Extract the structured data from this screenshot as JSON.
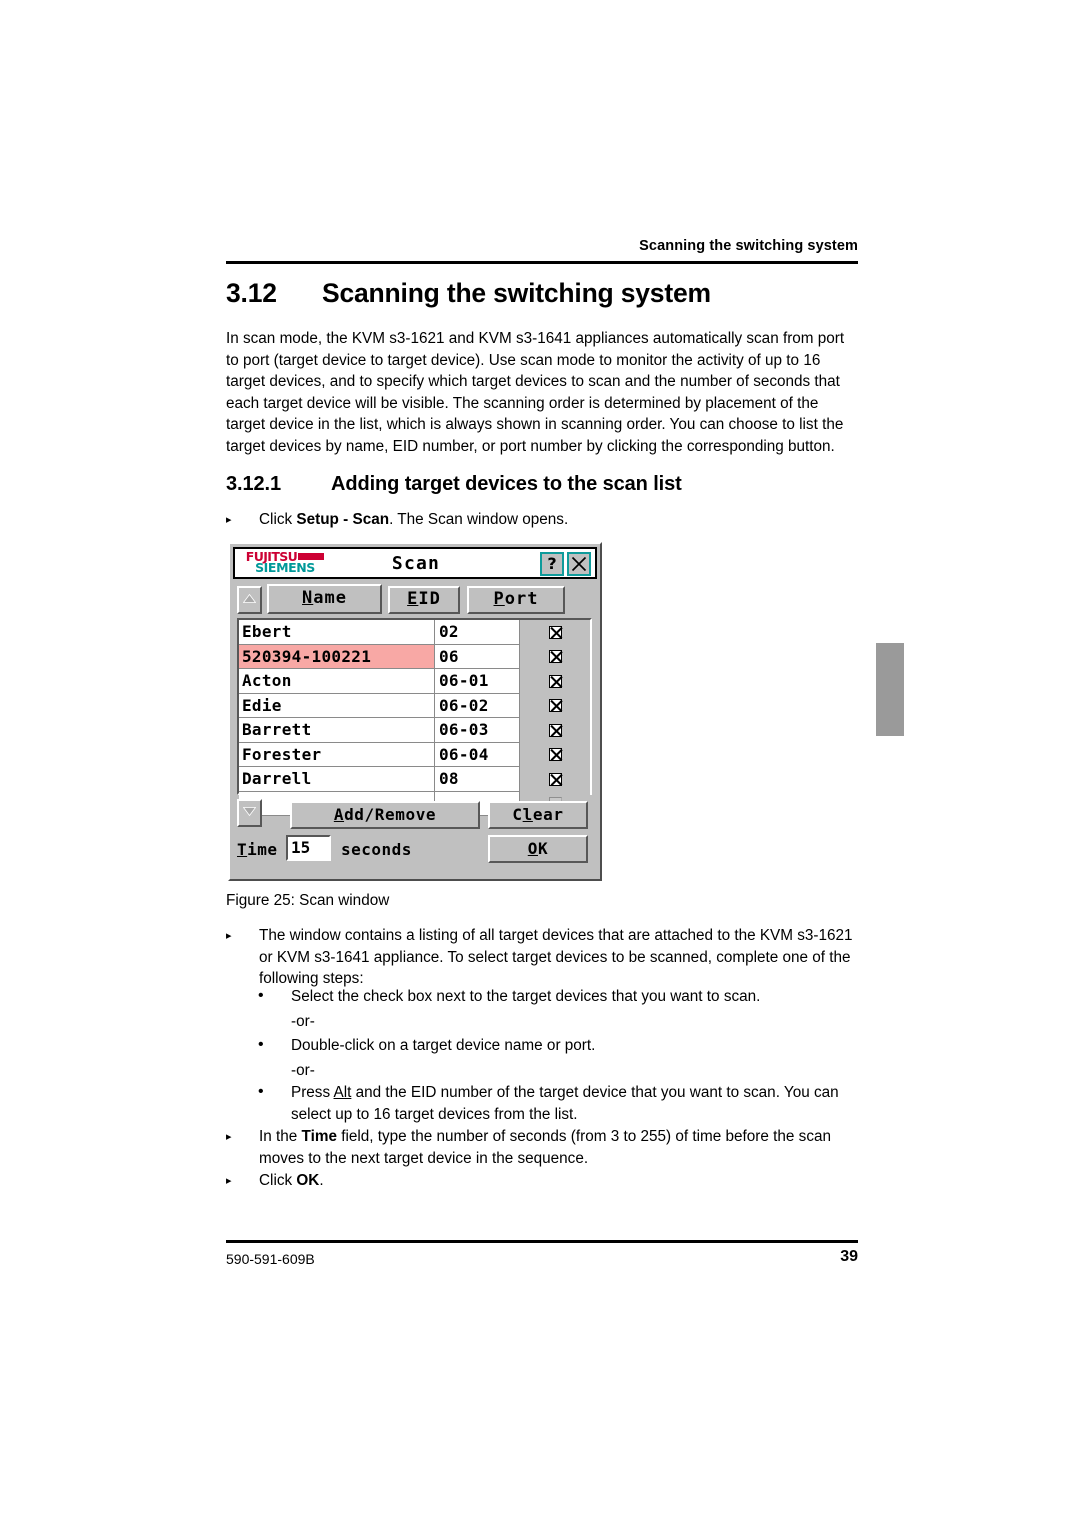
{
  "page": {
    "running_header": "Scanning the switching system",
    "footer_doc_number": "590-591-609B",
    "footer_page_number": "39"
  },
  "headings": {
    "section_number": "3.12",
    "section_title": "Scanning the switching system",
    "subsection_number": "3.12.1",
    "subsection_title": "Adding target devices to the scan list"
  },
  "body": {
    "intro_paragraph": "In scan mode, the KVM s3-1621 and KVM s3-1641 appliances automatically scan from port to port (target device to target device). Use scan mode to monitor the activity of up to 16 target devices, and to specify which target devices to scan and the number of seconds that each target device will be visible. The scanning order is determined by placement of the target device in the list, which is always shown in scanning order. You can choose to list the target devices by name, EID number, or port number by clicking the corresponding button."
  },
  "steps": {
    "click_setup_scan": {
      "prefix": "Click ",
      "bold": "Setup - Scan",
      "suffix": ". The Scan window opens."
    },
    "window_contains": "The window contains a listing of all target devices that are attached to the KVM s3-1621 or KVM s3-1641 appliance. To select target devices to be scanned, complete one of the following steps:",
    "option_checkbox": "Select the check box next to the target devices that you want to scan.",
    "or_1": "-or-",
    "option_doubleclick": "Double-click on a target device name or port.",
    "or_2": "-or-",
    "option_alt": {
      "prefix": "Press ",
      "underline": "Alt",
      "suffix": " and the EID number of the target device that you want to scan. You can select up to 16 target devices from the list."
    },
    "time_field": {
      "prefix": "In the ",
      "bold": "Time",
      "suffix": " field, type the number of seconds (from 3 to 255) of time before the scan moves to the next target device in the sequence."
    },
    "click_ok": {
      "prefix": "Click ",
      "bold": "OK",
      "suffix": "."
    }
  },
  "figure": {
    "caption": "Figure 25: Scan window"
  },
  "scan_dialog": {
    "title": "Scan",
    "logo": {
      "line1": "FUJITSU",
      "line2": "SIEMENS",
      "line1_color": "#cc0033",
      "line2_color": "#009999"
    },
    "titlebar_buttons": {
      "help": "?",
      "close": "close-icon",
      "border_color": "#0f9b9b"
    },
    "column_buttons": [
      {
        "label": "Name",
        "accel": "N"
      },
      {
        "label": "EID",
        "accel": "E"
      },
      {
        "label": "Port",
        "accel": "P"
      }
    ],
    "scroll_up_icon": "triangle-up-icon",
    "scroll_down_icon": "triangle-down-icon",
    "selected_row_color": "#f8a8a5",
    "rows": [
      {
        "name": "Ebert",
        "eid": "02",
        "checked": true,
        "selected": false
      },
      {
        "name": "520394-100221",
        "eid": "06",
        "checked": true,
        "selected": true
      },
      {
        "name": "Acton",
        "eid": "06-01",
        "checked": true,
        "selected": false
      },
      {
        "name": "Edie",
        "eid": "06-02",
        "checked": true,
        "selected": false
      },
      {
        "name": "Barrett",
        "eid": "06-03",
        "checked": true,
        "selected": false
      },
      {
        "name": "Forester",
        "eid": "06-04",
        "checked": true,
        "selected": false
      },
      {
        "name": "Darrell",
        "eid": "08",
        "checked": true,
        "selected": false
      },
      {
        "name": "",
        "eid": "",
        "checked": false,
        "selected": false
      }
    ],
    "buttons": {
      "add_remove": "Add/Remove",
      "clear": "Clear",
      "ok": "OK"
    },
    "time": {
      "label": "Time",
      "value": "15",
      "units": "seconds"
    }
  }
}
